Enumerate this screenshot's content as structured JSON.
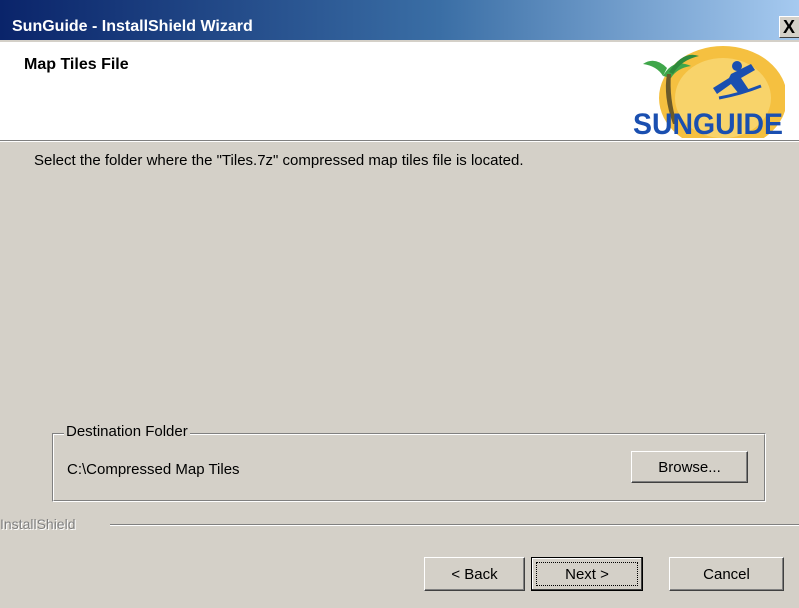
{
  "window": {
    "title": "SunGuide - InstallShield Wizard",
    "close_label": "X"
  },
  "header": {
    "title": "Map Tiles File",
    "logo_text": "SUNGUIDE"
  },
  "main": {
    "instruction": "Select the folder where the \"Tiles.7z\" compressed map tiles file is located.",
    "destination": {
      "legend": "Destination Folder",
      "path": "C:\\Compressed Map Tiles",
      "browse_label": "Browse..."
    }
  },
  "footer": {
    "brand": "InstallShield",
    "back_label": "< Back",
    "next_label": "Next >",
    "cancel_label": "Cancel"
  },
  "colors": {
    "titlebar_start": "#0a246a",
    "titlebar_end": "#a6caf0",
    "dialog_bg": "#d4d0c8",
    "logo_sun": "#f5c040",
    "logo_blue": "#1a4fb0",
    "logo_green": "#3fa64a"
  },
  "icons": {
    "close": "close-icon",
    "logo": "sunguide-logo"
  }
}
